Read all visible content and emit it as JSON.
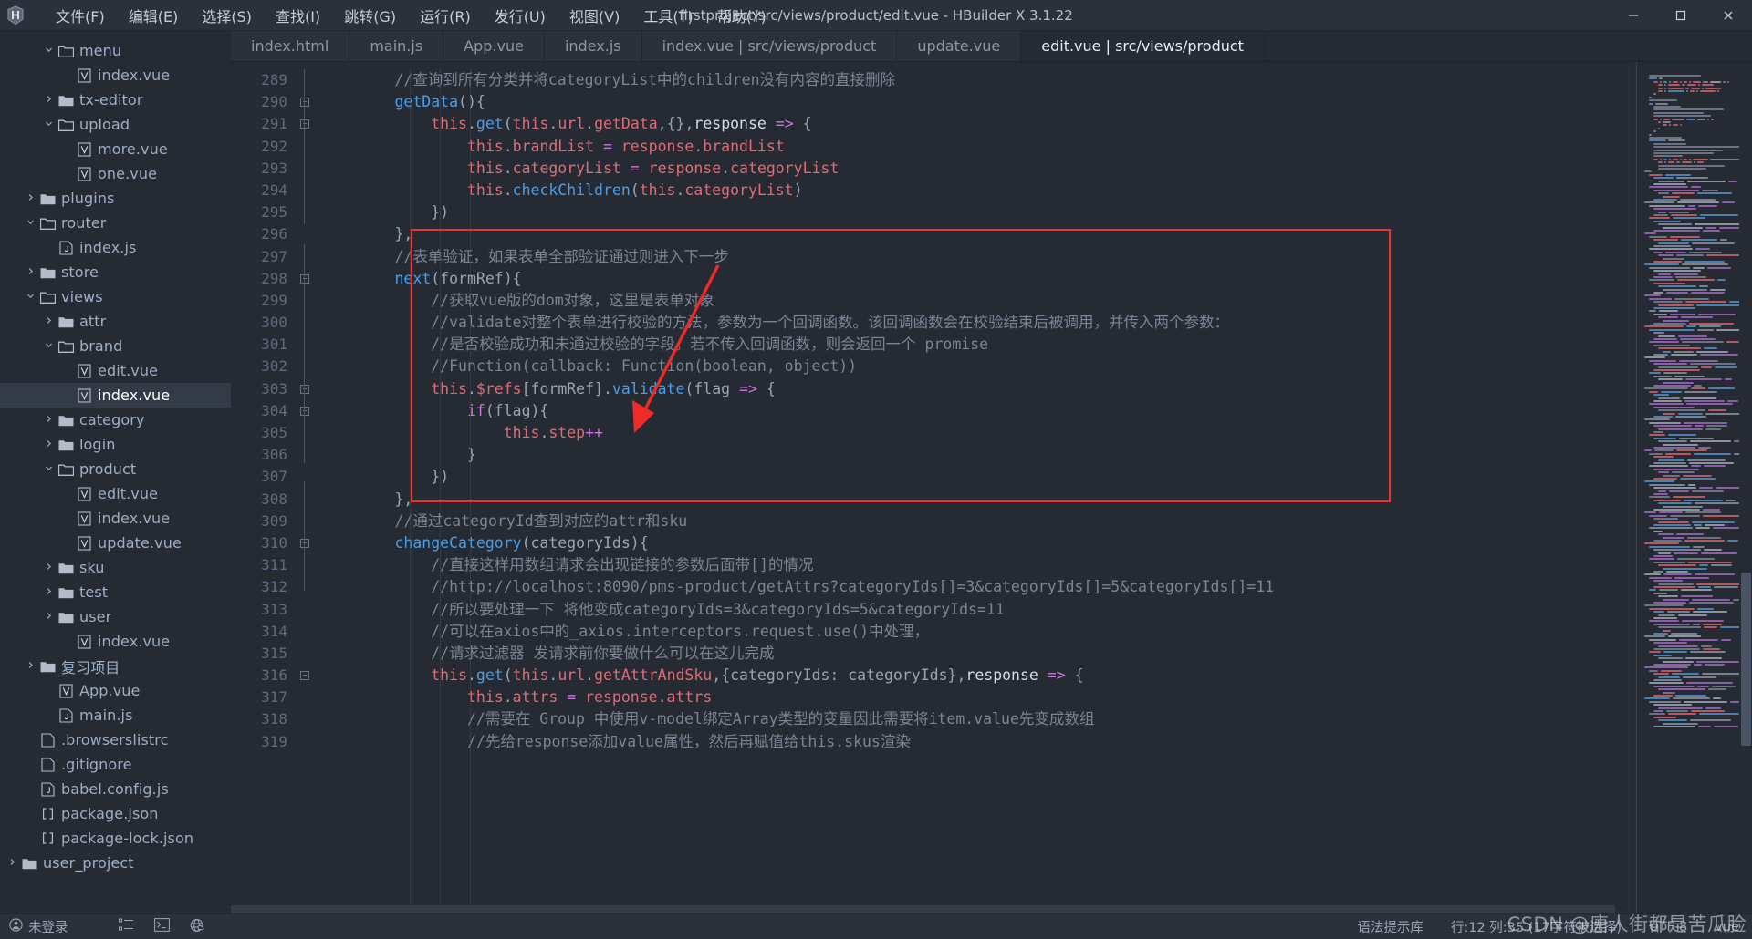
{
  "window": {
    "title": "firstproject/src/views/product/edit.vue - HBuilder X 3.1.22",
    "logo_icon": "hbuilder-logo-icon",
    "minimize_icon": "minimize-icon",
    "maximize_icon": "maximize-icon",
    "close_icon": "close-icon"
  },
  "menubar": {
    "items": [
      {
        "label": "文件(F)"
      },
      {
        "label": "编辑(E)"
      },
      {
        "label": "选择(S)"
      },
      {
        "label": "查找(I)"
      },
      {
        "label": "跳转(G)"
      },
      {
        "label": "运行(R)"
      },
      {
        "label": "发行(U)"
      },
      {
        "label": "视图(V)"
      },
      {
        "label": "工具(T)"
      },
      {
        "label": "帮助(Y)"
      }
    ]
  },
  "sidebar": {
    "items": [
      {
        "label": "menu",
        "indent": 2,
        "type": "folder-open",
        "twist": "v",
        "selected": false
      },
      {
        "label": "index.vue",
        "indent": 3,
        "type": "vue",
        "twist": "",
        "selected": false
      },
      {
        "label": "tx-editor",
        "indent": 2,
        "type": "folder",
        "twist": ">",
        "selected": false
      },
      {
        "label": "upload",
        "indent": 2,
        "type": "folder-open",
        "twist": "v",
        "selected": false
      },
      {
        "label": "more.vue",
        "indent": 3,
        "type": "vue",
        "twist": "",
        "selected": false
      },
      {
        "label": "one.vue",
        "indent": 3,
        "type": "vue",
        "twist": "",
        "selected": false
      },
      {
        "label": "plugins",
        "indent": 1,
        "type": "folder",
        "twist": ">",
        "selected": false
      },
      {
        "label": "router",
        "indent": 1,
        "type": "folder-open",
        "twist": "v",
        "selected": false
      },
      {
        "label": "index.js",
        "indent": 2,
        "type": "js",
        "twist": "",
        "selected": false
      },
      {
        "label": "store",
        "indent": 1,
        "type": "folder",
        "twist": ">",
        "selected": false
      },
      {
        "label": "views",
        "indent": 1,
        "type": "folder-open",
        "twist": "v",
        "selected": false
      },
      {
        "label": "attr",
        "indent": 2,
        "type": "folder",
        "twist": ">",
        "selected": false
      },
      {
        "label": "brand",
        "indent": 2,
        "type": "folder-open",
        "twist": "v",
        "selected": false
      },
      {
        "label": "edit.vue",
        "indent": 3,
        "type": "vue",
        "twist": "",
        "selected": false
      },
      {
        "label": "index.vue",
        "indent": 3,
        "type": "vue",
        "twist": "",
        "selected": true
      },
      {
        "label": "category",
        "indent": 2,
        "type": "folder",
        "twist": ">",
        "selected": false
      },
      {
        "label": "login",
        "indent": 2,
        "type": "folder",
        "twist": ">",
        "selected": false
      },
      {
        "label": "product",
        "indent": 2,
        "type": "folder-open",
        "twist": "v",
        "selected": false
      },
      {
        "label": "edit.vue",
        "indent": 3,
        "type": "vue",
        "twist": "",
        "selected": false
      },
      {
        "label": "index.vue",
        "indent": 3,
        "type": "vue",
        "twist": "",
        "selected": false
      },
      {
        "label": "update.vue",
        "indent": 3,
        "type": "vue",
        "twist": "",
        "selected": false
      },
      {
        "label": "sku",
        "indent": 2,
        "type": "folder",
        "twist": ">",
        "selected": false
      },
      {
        "label": "test",
        "indent": 2,
        "type": "folder",
        "twist": ">",
        "selected": false
      },
      {
        "label": "user",
        "indent": 2,
        "type": "folder",
        "twist": ">",
        "selected": false
      },
      {
        "label": "index.vue",
        "indent": 3,
        "type": "vue",
        "twist": "",
        "selected": false
      },
      {
        "label": "复习项目",
        "indent": 1,
        "type": "folder",
        "twist": ">",
        "selected": false
      },
      {
        "label": "App.vue",
        "indent": 2,
        "type": "vue",
        "twist": "",
        "selected": false
      },
      {
        "label": "main.js",
        "indent": 2,
        "type": "js",
        "twist": "",
        "selected": false
      },
      {
        "label": ".browserslistrc",
        "indent": 1,
        "type": "plain",
        "twist": "",
        "selected": false
      },
      {
        "label": ".gitignore",
        "indent": 1,
        "type": "plain",
        "twist": "",
        "selected": false
      },
      {
        "label": "babel.config.js",
        "indent": 1,
        "type": "js",
        "twist": "",
        "selected": false
      },
      {
        "label": "package.json",
        "indent": 1,
        "type": "json",
        "twist": "",
        "selected": false
      },
      {
        "label": "package-lock.json",
        "indent": 1,
        "type": "json",
        "twist": "",
        "selected": false
      },
      {
        "label": "user_project",
        "indent": 0,
        "type": "folder",
        "twist": ">",
        "selected": false
      }
    ]
  },
  "tabs": [
    {
      "label": "index.html",
      "active": false
    },
    {
      "label": "main.js",
      "active": false
    },
    {
      "label": "App.vue",
      "active": false
    },
    {
      "label": "index.js",
      "active": false
    },
    {
      "label": "index.vue | src/views/product",
      "active": false
    },
    {
      "label": "update.vue",
      "active": false
    },
    {
      "label": "edit.vue | src/views/product",
      "active": true
    }
  ],
  "editor": {
    "first_line_number": 289,
    "fold_lines": [
      290,
      291,
      298,
      303,
      304,
      310,
      316
    ],
    "lines": [
      {
        "n": 289,
        "indent": 2,
        "tokens": [
          {
            "t": "//查询到所有分类并将categoryList中的children没有内容的直接删除",
            "c": "cm"
          }
        ]
      },
      {
        "n": 290,
        "indent": 2,
        "tokens": [
          {
            "t": "getData",
            "c": "fn"
          },
          {
            "t": "(){",
            "c": "pn"
          }
        ]
      },
      {
        "n": 291,
        "indent": 3,
        "tokens": [
          {
            "t": "this",
            "c": "va"
          },
          {
            "t": ".",
            "c": "pn"
          },
          {
            "t": "get",
            "c": "fn"
          },
          {
            "t": "(",
            "c": "pn"
          },
          {
            "t": "this",
            "c": "va"
          },
          {
            "t": ".",
            "c": "pn"
          },
          {
            "t": "url",
            "c": "va"
          },
          {
            "t": ".",
            "c": "pn"
          },
          {
            "t": "getData",
            "c": "va"
          },
          {
            "t": ",{},",
            "c": "pn"
          },
          {
            "t": "response ",
            "c": "pl"
          },
          {
            "t": "=>",
            "c": "ar"
          },
          {
            "t": " {",
            "c": "pn"
          }
        ]
      },
      {
        "n": 292,
        "indent": 4,
        "tokens": [
          {
            "t": "this",
            "c": "va"
          },
          {
            "t": ".",
            "c": "pn"
          },
          {
            "t": "brandList",
            "c": "va"
          },
          {
            "t": " = ",
            "c": "ar"
          },
          {
            "t": "response",
            "c": "va"
          },
          {
            "t": ".",
            "c": "pn"
          },
          {
            "t": "brandList",
            "c": "va"
          }
        ]
      },
      {
        "n": 293,
        "indent": 4,
        "tokens": [
          {
            "t": "this",
            "c": "va"
          },
          {
            "t": ".",
            "c": "pn"
          },
          {
            "t": "categoryList",
            "c": "va"
          },
          {
            "t": " = ",
            "c": "ar"
          },
          {
            "t": "response",
            "c": "va"
          },
          {
            "t": ".",
            "c": "pn"
          },
          {
            "t": "categoryList",
            "c": "va"
          }
        ]
      },
      {
        "n": 294,
        "indent": 4,
        "tokens": [
          {
            "t": "this",
            "c": "va"
          },
          {
            "t": ".",
            "c": "pn"
          },
          {
            "t": "checkChildren",
            "c": "fn"
          },
          {
            "t": "(",
            "c": "pn"
          },
          {
            "t": "this",
            "c": "va"
          },
          {
            "t": ".",
            "c": "pn"
          },
          {
            "t": "categoryList",
            "c": "va"
          },
          {
            "t": ")",
            "c": "pn"
          }
        ]
      },
      {
        "n": 295,
        "indent": 3,
        "tokens": [
          {
            "t": "})",
            "c": "pn"
          }
        ]
      },
      {
        "n": 296,
        "indent": 2,
        "tokens": [
          {
            "t": "},",
            "c": "pn"
          }
        ]
      },
      {
        "n": 297,
        "indent": 2,
        "tokens": [
          {
            "t": "//表单验证，如果表单全部验证通过则进入下一步",
            "c": "cm"
          }
        ]
      },
      {
        "n": 298,
        "indent": 2,
        "tokens": [
          {
            "t": "next",
            "c": "fn"
          },
          {
            "t": "(formRef){",
            "c": "pn"
          }
        ]
      },
      {
        "n": 299,
        "indent": 3,
        "tokens": [
          {
            "t": "//获取vue版的dom对象，这里是表单对象",
            "c": "cm"
          }
        ]
      },
      {
        "n": 300,
        "indent": 3,
        "tokens": [
          {
            "t": "//validate对整个表单进行校验的方法，参数为一个回调函数。该回调函数会在校验结束后被调用，并传入两个参数：",
            "c": "cm"
          }
        ]
      },
      {
        "n": 301,
        "indent": 3,
        "tokens": [
          {
            "t": "//是否校验成功和未通过校验的字段。若不传入回调函数，则会返回一个 promise",
            "c": "cm"
          }
        ]
      },
      {
        "n": 302,
        "indent": 3,
        "tokens": [
          {
            "t": "//Function(callback: Function(boolean, object))",
            "c": "cm"
          }
        ]
      },
      {
        "n": 303,
        "indent": 3,
        "tokens": [
          {
            "t": "this",
            "c": "va"
          },
          {
            "t": ".",
            "c": "pn"
          },
          {
            "t": "$refs",
            "c": "va"
          },
          {
            "t": "[formRef].",
            "c": "pn"
          },
          {
            "t": "validate",
            "c": "fn"
          },
          {
            "t": "(flag ",
            "c": "pn"
          },
          {
            "t": "=>",
            "c": "ar"
          },
          {
            "t": " {",
            "c": "pn"
          }
        ]
      },
      {
        "n": 304,
        "indent": 4,
        "tokens": [
          {
            "t": "if",
            "c": "kw"
          },
          {
            "t": "(flag){",
            "c": "pn"
          }
        ]
      },
      {
        "n": 305,
        "indent": 5,
        "tokens": [
          {
            "t": "this",
            "c": "va"
          },
          {
            "t": ".",
            "c": "pn"
          },
          {
            "t": "step",
            "c": "va"
          },
          {
            "t": "++",
            "c": "ar"
          }
        ]
      },
      {
        "n": 306,
        "indent": 4,
        "tokens": [
          {
            "t": "}",
            "c": "pn"
          }
        ]
      },
      {
        "n": 307,
        "indent": 3,
        "tokens": [
          {
            "t": "})",
            "c": "pn"
          }
        ]
      },
      {
        "n": 308,
        "indent": 2,
        "tokens": [
          {
            "t": "},",
            "c": "pn"
          }
        ]
      },
      {
        "n": 309,
        "indent": 2,
        "tokens": [
          {
            "t": "//通过categoryId查到对应的attr和sku",
            "c": "cm"
          }
        ]
      },
      {
        "n": 310,
        "indent": 2,
        "tokens": [
          {
            "t": "changeCategory",
            "c": "fn"
          },
          {
            "t": "(categoryIds){",
            "c": "pn"
          }
        ]
      },
      {
        "n": 311,
        "indent": 3,
        "tokens": [
          {
            "t": "//直接这样用数组请求会出现链接的参数后面带[]的情况",
            "c": "cm"
          }
        ]
      },
      {
        "n": 312,
        "indent": 3,
        "tokens": [
          {
            "t": "//http://localhost:8090/pms-product/getAttrs?categoryIds[]=3&categoryIds[]=5&categoryIds[]=11",
            "c": "cm"
          }
        ]
      },
      {
        "n": 313,
        "indent": 3,
        "tokens": [
          {
            "t": "//所以要处理一下 将他变成categoryIds=3&categoryIds=5&categoryIds=11",
            "c": "cm"
          }
        ]
      },
      {
        "n": 314,
        "indent": 3,
        "tokens": [
          {
            "t": "//可以在axios中的_axios.interceptors.request.use()中处理，",
            "c": "cm"
          }
        ]
      },
      {
        "n": 315,
        "indent": 3,
        "tokens": [
          {
            "t": "//请求过滤器 发请求前你要做什么可以在这儿完成",
            "c": "cm"
          }
        ]
      },
      {
        "n": 316,
        "indent": 3,
        "tokens": [
          {
            "t": "this",
            "c": "va"
          },
          {
            "t": ".",
            "c": "pn"
          },
          {
            "t": "get",
            "c": "fn"
          },
          {
            "t": "(",
            "c": "pn"
          },
          {
            "t": "this",
            "c": "va"
          },
          {
            "t": ".",
            "c": "pn"
          },
          {
            "t": "url",
            "c": "va"
          },
          {
            "t": ".",
            "c": "pn"
          },
          {
            "t": "getAttrAndSku",
            "c": "va"
          },
          {
            "t": ",{categoryIds: categoryIds},",
            "c": "pn"
          },
          {
            "t": "response ",
            "c": "pl"
          },
          {
            "t": "=>",
            "c": "ar"
          },
          {
            "t": " {",
            "c": "pn"
          }
        ]
      },
      {
        "n": 317,
        "indent": 4,
        "tokens": [
          {
            "t": "this",
            "c": "va"
          },
          {
            "t": ".",
            "c": "pn"
          },
          {
            "t": "attrs",
            "c": "va"
          },
          {
            "t": " = ",
            "c": "ar"
          },
          {
            "t": "response",
            "c": "va"
          },
          {
            "t": ".",
            "c": "pn"
          },
          {
            "t": "attrs",
            "c": "va"
          }
        ]
      },
      {
        "n": 318,
        "indent": 4,
        "tokens": [
          {
            "t": "//需要在 Group 中使用v-model绑定Array类型的变量因此需要将item.value先变成数组",
            "c": "cm"
          }
        ]
      },
      {
        "n": 319,
        "indent": 4,
        "tokens": [
          {
            "t": "//先给response添加value属性，然后再赋值给this.skus渲染",
            "c": "cm"
          }
        ]
      }
    ],
    "annotation": {
      "redbox_label": "highlight-rectangle",
      "arrow_label": "red-arrow-pointer"
    }
  },
  "statusbar": {
    "user": "未登录",
    "user_icon": "account-icon",
    "icons": [
      "outline-list-icon",
      "terminal-icon",
      "globe-cloud-icon"
    ],
    "syntax_lib": "语法提示库",
    "position": "行:12  列:35 (17字符被选择)",
    "encoding": "UTF-8",
    "language": "vue",
    "watermark": "CSDN @唐人街都是苦瓜脸"
  },
  "colors": {
    "bg": "#252a33",
    "panel": "#2b303b",
    "accent_red": "#f0322e",
    "comment": "#7b8596",
    "variable": "#e06c75",
    "function": "#4a9ee8",
    "keyword": "#c678dd"
  }
}
